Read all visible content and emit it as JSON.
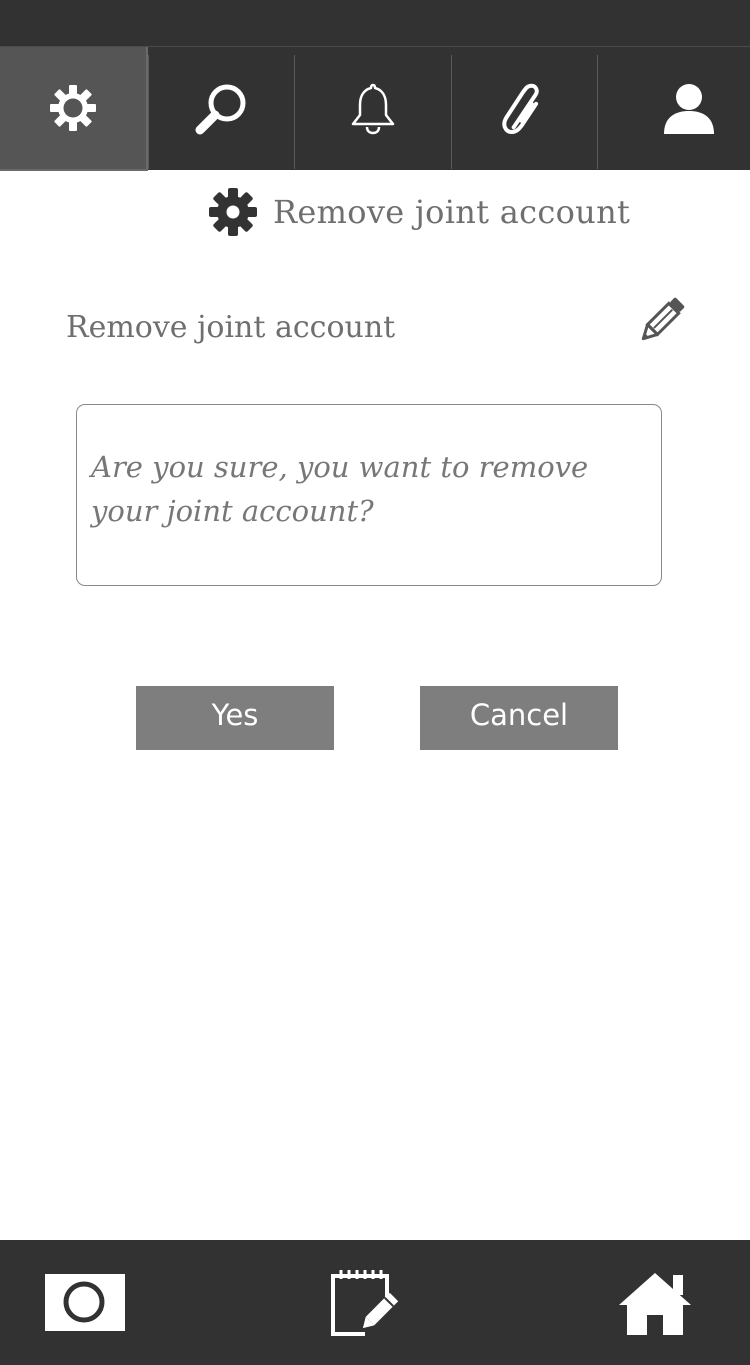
{
  "top_nav": {
    "tabs": [
      {
        "id": "settings",
        "icon": "gear-icon",
        "active": true
      },
      {
        "id": "search",
        "icon": "search-icon",
        "active": false
      },
      {
        "id": "notifications",
        "icon": "bell-icon",
        "active": false
      },
      {
        "id": "attachments",
        "icon": "paperclip-icon",
        "active": false
      },
      {
        "id": "profile",
        "icon": "user-icon",
        "active": false
      }
    ]
  },
  "page": {
    "heading": "Remove joint account",
    "heading_icon": "gear-icon"
  },
  "section": {
    "label": "Remove joint account",
    "edit_icon": "pencil-icon"
  },
  "dialog": {
    "message": "Are you sure, you want to remove your joint account?",
    "yes_label": "Yes",
    "cancel_label": "Cancel"
  },
  "bottom_bar": {
    "items": [
      {
        "id": "camera",
        "icon": "camera-icon"
      },
      {
        "id": "notes",
        "icon": "notepad-edit-icon"
      },
      {
        "id": "home",
        "icon": "home-icon"
      }
    ]
  },
  "colors": {
    "bar_background": "#323232",
    "active_tab": "#555555",
    "button": "#7e7e7e",
    "text": "#6f6f6f"
  }
}
